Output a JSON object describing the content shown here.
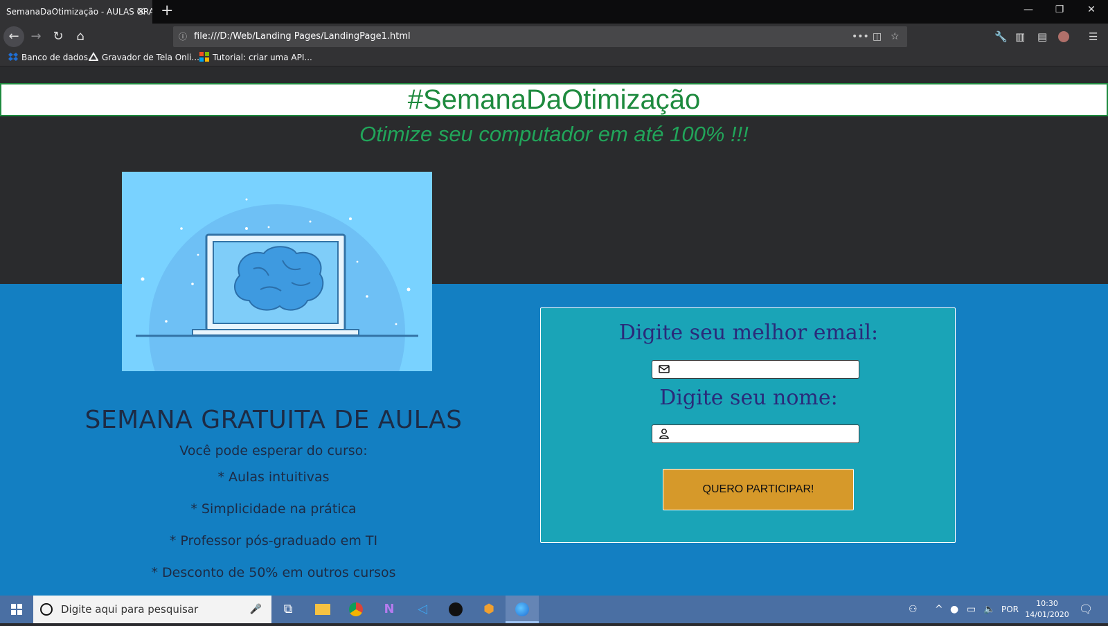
{
  "browser": {
    "tab_title": "SemanaDaOtimização - AULAS GRA",
    "url": "file:///D:/Web/Landing Pages/LandingPage1.html",
    "bookmarks": [
      {
        "label": "Banco de dados",
        "icon": "dropbox-icon"
      },
      {
        "label": "Gravador de Tela Onli...",
        "icon": "triangle-logo-icon"
      },
      {
        "label": "Tutorial: criar uma API...",
        "icon": "microsoft-logo-icon"
      }
    ]
  },
  "page": {
    "hashtag": "#SemanaDaOtimização",
    "subtitle": "Otimize seu computador em até 100% !!!",
    "hero_image": "laptop-brain-illustration",
    "course_title": "SEMANA GRATUITA DE AULAS",
    "course_intro": "Você pode esperar do curso:",
    "bullets": [
      "* Aulas intuitivas",
      "* Simplicidade na prática",
      "* Professor pós-graduado em TI",
      "* Desconto de 50% em outros cursos"
    ],
    "form": {
      "email_label": "Digite seu melhor email:",
      "email_value": "",
      "name_label": "Digite seu nome:",
      "name_value": "",
      "submit_label": "QUERO PARTICIPAR!"
    }
  },
  "taskbar": {
    "search_placeholder": "Digite aqui para pesquisar",
    "language": "POR",
    "time": "10:30",
    "date": "14/01/2020"
  },
  "colors": {
    "hashtag_green": "#1e8a3e",
    "subtitle_green": "#21a55a",
    "page_dark": "#2a2b2d",
    "page_blue": "#137fc2",
    "form_teal": "#1aa4b7",
    "button_gold": "#d6992a",
    "label_navy": "#2a2a7a"
  }
}
